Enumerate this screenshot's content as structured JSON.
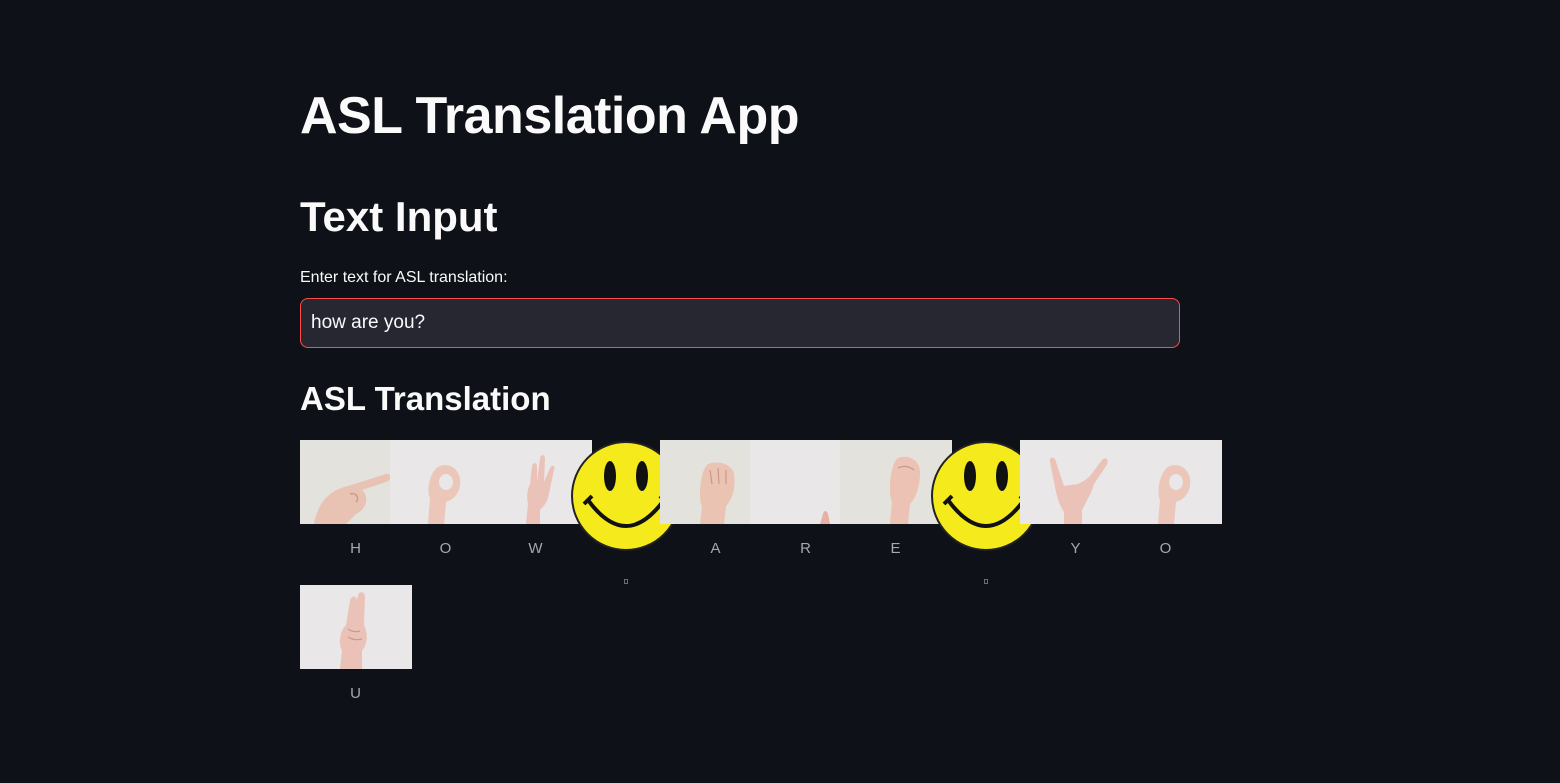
{
  "app": {
    "title": "ASL Translation App"
  },
  "text_input_section": {
    "heading": "Text Input",
    "label": "Enter text for ASL translation:",
    "value": "how are you?"
  },
  "translation": {
    "heading": "ASL Translation",
    "letters": [
      "H",
      "O",
      "W",
      "",
      "A",
      "R",
      "E",
      "",
      "Y",
      "O",
      "U"
    ]
  },
  "colors": {
    "background": "#0e1117",
    "input_border": "#ff4b4b",
    "smiley": "#f5ea1c"
  }
}
